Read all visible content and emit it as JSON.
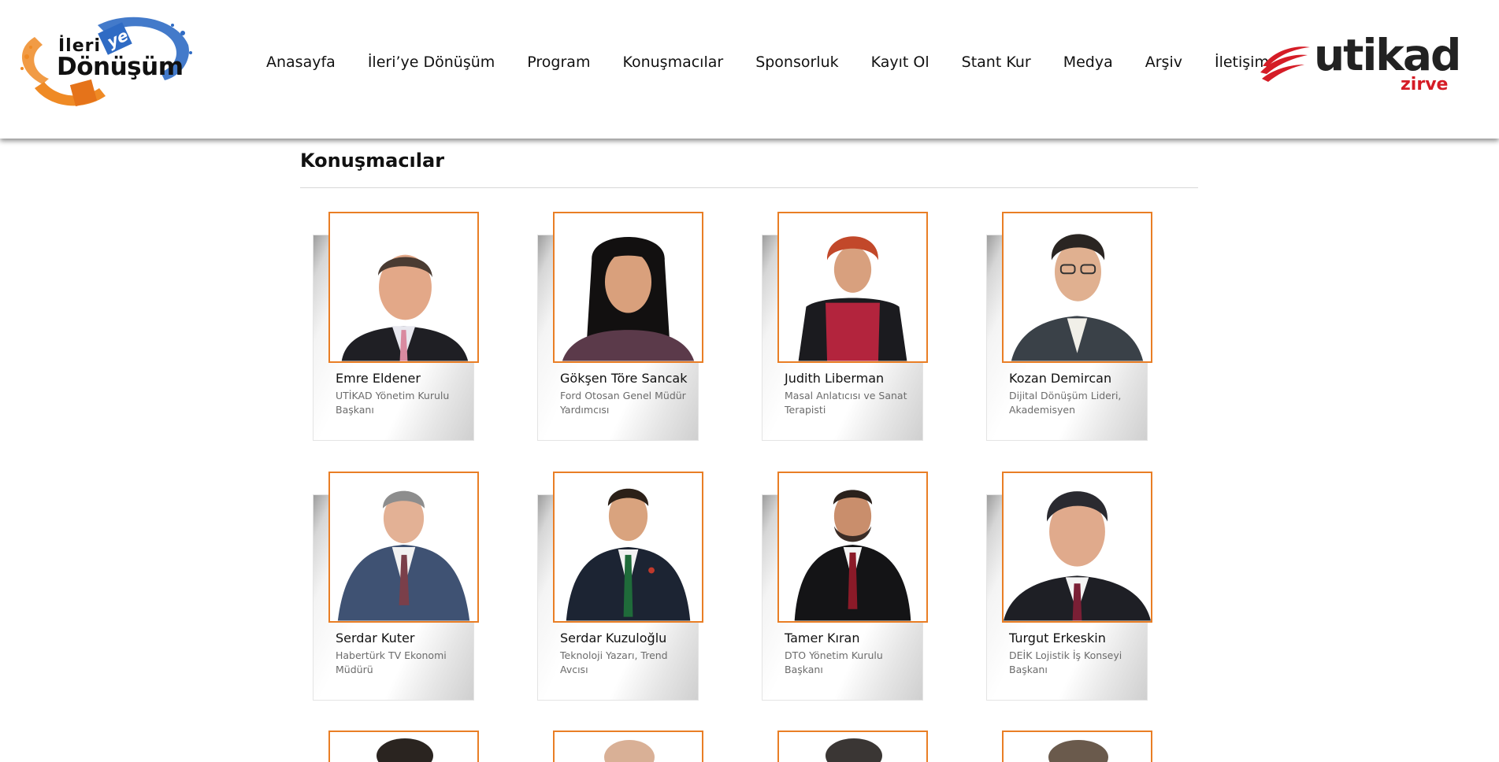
{
  "header": {
    "logo_left": {
      "line1": "İleri",
      "badge": "ye",
      "line2": "Dönüşüm"
    },
    "nav": [
      "Anasayfa",
      "İleri’ye Dönüşüm",
      "Program",
      "Konuşmacılar",
      "Sponsorluk",
      "Kayıt Ol",
      "Stant Kur",
      "Medya",
      "Arşiv",
      "İletişim"
    ],
    "logo_right": {
      "text": "utikad",
      "sub": "zirve"
    }
  },
  "main": {
    "section_title": "Konuşmacılar",
    "speakers": [
      {
        "name": "Emre Eldener",
        "role": "UTİKAD Yönetim Kurulu Başkanı"
      },
      {
        "name": "Gökşen Töre Sancak",
        "role": "Ford Otosan Genel Müdür Yardımcısı"
      },
      {
        "name": "Judith Liberman",
        "role": "Masal Anlatıcısı ve Sanat Terapisti"
      },
      {
        "name": "Kozan Demircan",
        "role": "Dijital Dönüşüm Lideri, Akademisyen"
      },
      {
        "name": "Serdar Kuter",
        "role": "Habertürk TV Ekonomi Müdürü"
      },
      {
        "name": "Serdar Kuzuloğlu",
        "role": "Teknoloji Yazarı, Trend Avcısı"
      },
      {
        "name": "Tamer Kıran",
        "role": "DTO Yönetim Kurulu Başkanı"
      },
      {
        "name": "Turgut Erkeskin",
        "role": "DEİK Lojistik İş Konseyi Başkanı"
      }
    ]
  },
  "colors": {
    "accent": "#e97e25",
    "brand_red": "#d51c26",
    "logo_blue": "#2f6bc4",
    "logo_orange": "#ef8a25"
  }
}
